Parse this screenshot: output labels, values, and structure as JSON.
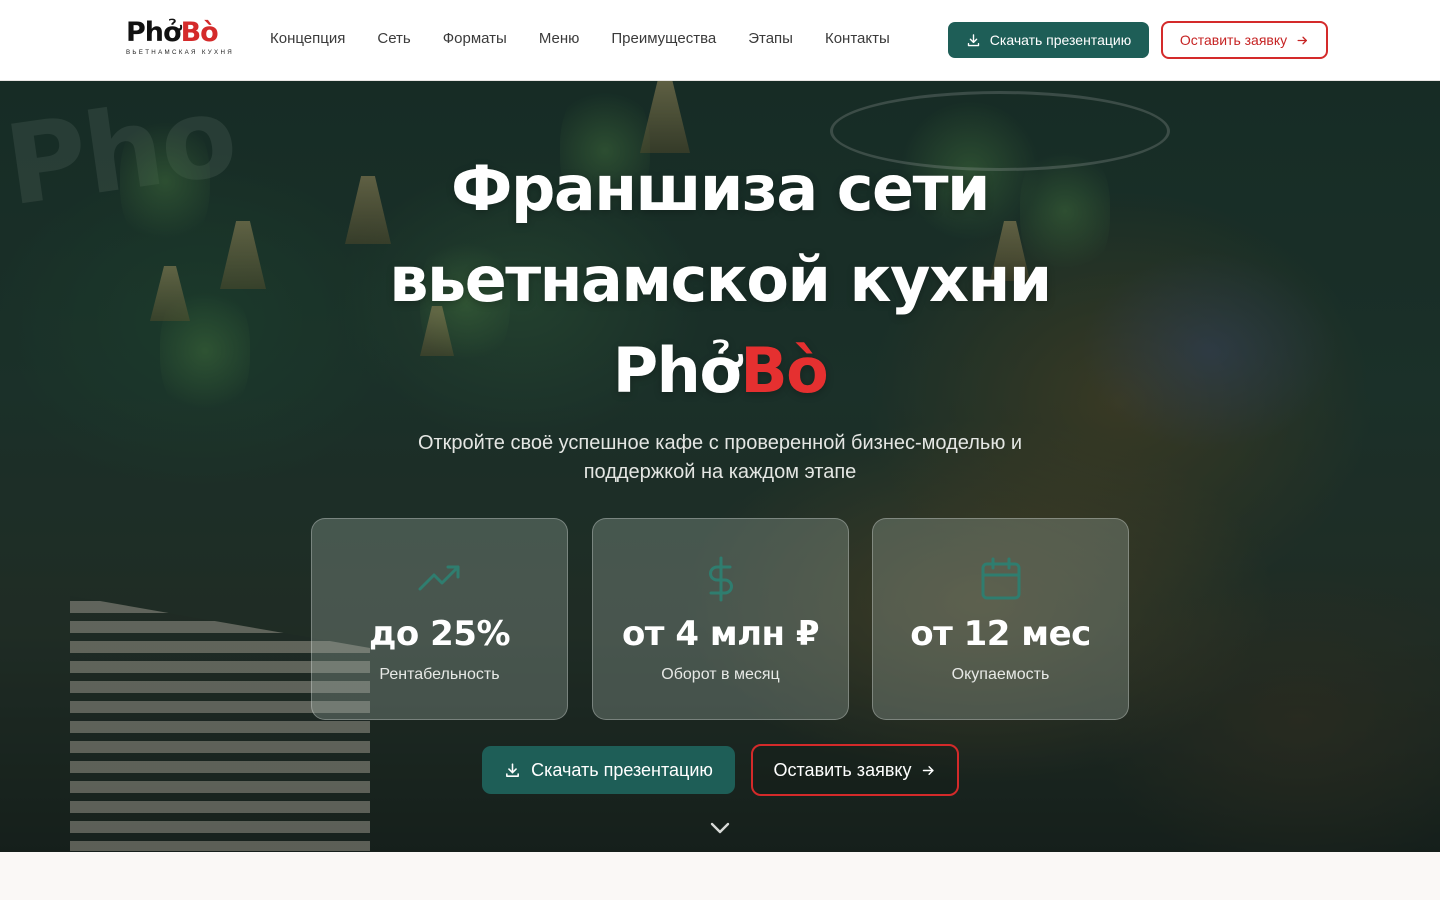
{
  "header": {
    "logo": {
      "word_pho": "Phở",
      "word_bo": "Bò",
      "subtitle": "ВЬЕТНАМСКАЯ КУХНЯ"
    },
    "nav": [
      {
        "label": "Концепция"
      },
      {
        "label": "Сеть"
      },
      {
        "label": "Форматы"
      },
      {
        "label": "Меню"
      },
      {
        "label": "Преимущества"
      },
      {
        "label": "Этапы"
      },
      {
        "label": "Контакты"
      }
    ],
    "download_label": "Скачать презентацию",
    "request_label": "Оставить заявку"
  },
  "hero": {
    "title_line1": "Франшиза сети",
    "title_line2": "вьетнамской кухни",
    "brand_pho": "Phở",
    "brand_bo": "Bò",
    "subtitle": "Откройте своё успешное кафе с проверенной бизнес-моделью и поддержкой на каждом этапе",
    "stats": [
      {
        "value": "до 25%",
        "label": "Рентабельность",
        "icon": "trending-up-icon"
      },
      {
        "value": "от 4 млн ₽",
        "label": "Оборот в месяц",
        "icon": "dollar-icon"
      },
      {
        "value": "от 12 мес",
        "label": "Окупаемость",
        "icon": "calendar-icon"
      }
    ],
    "download_label": "Скачать презентацию",
    "request_label": "Оставить заявку"
  },
  "colors": {
    "brand_green": "#1e5e57",
    "brand_red": "#d42a2a",
    "icon_teal": "#2f7d6f"
  }
}
